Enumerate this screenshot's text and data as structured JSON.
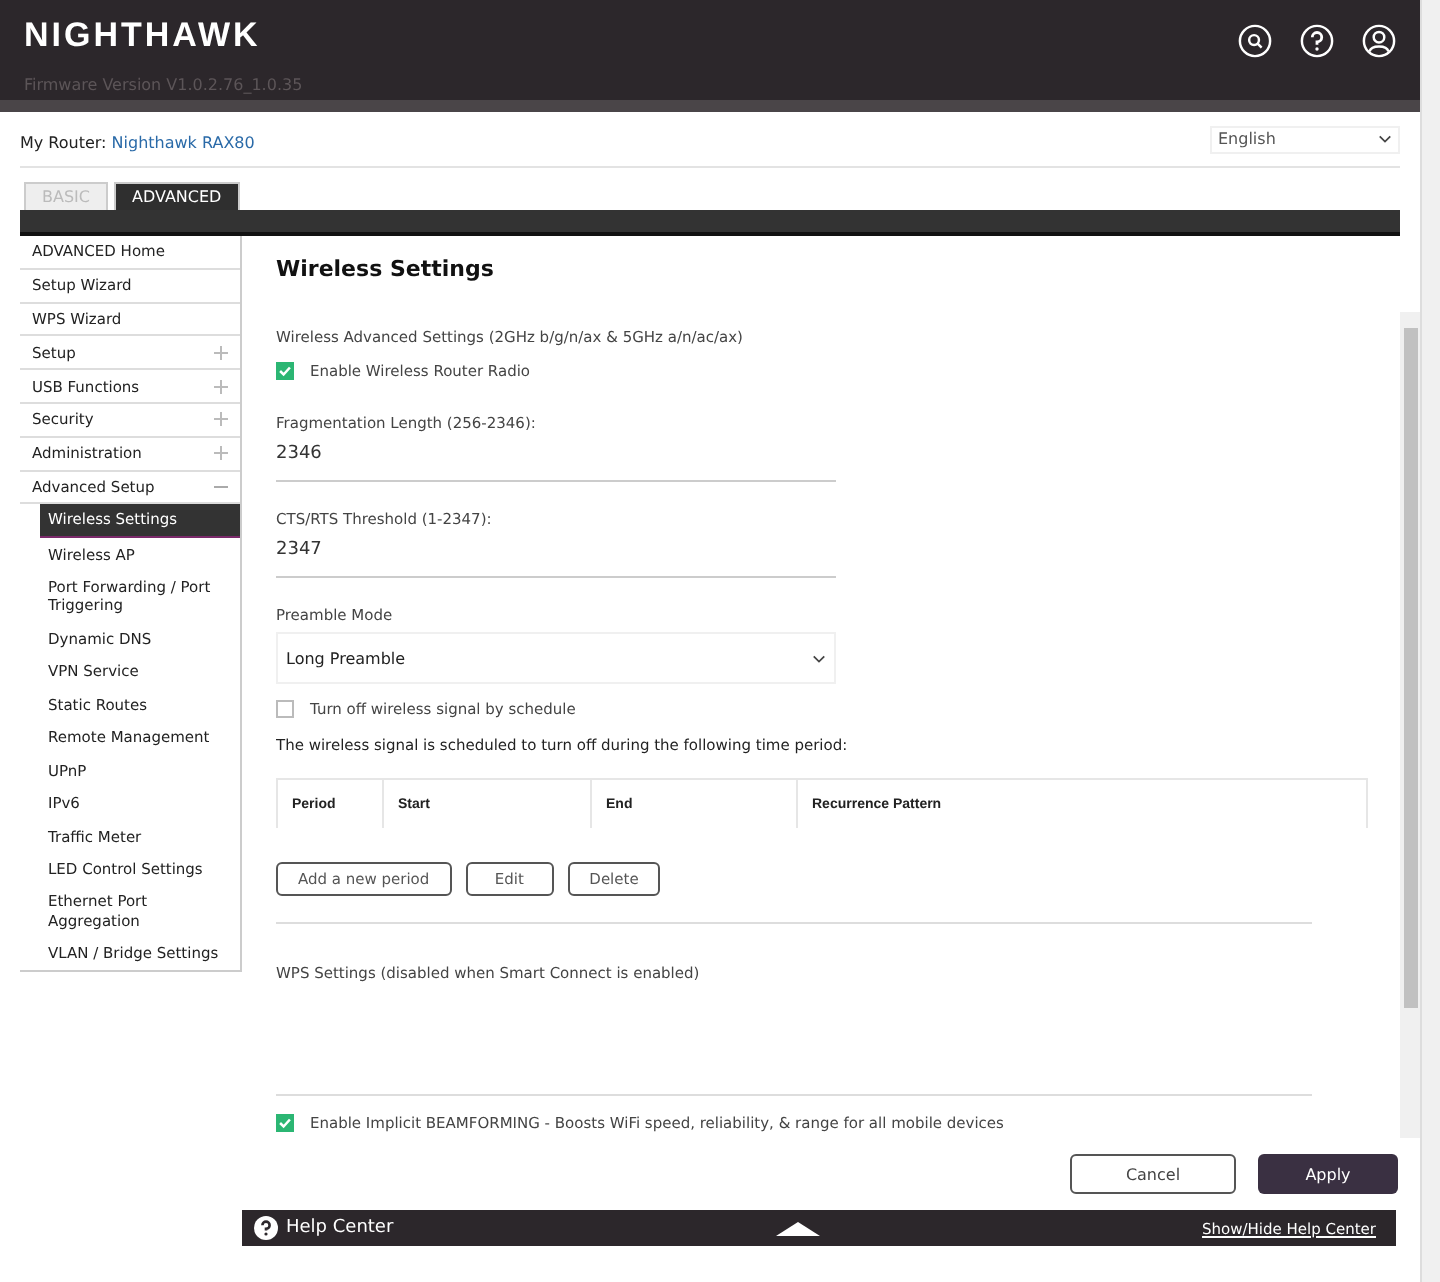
{
  "header": {
    "logo": "NIGHTHAWK",
    "firmware": "Firmware Version V1.0.2.76_1.0.35"
  },
  "router": {
    "label": "My Router:",
    "name": "Nighthawk RAX80"
  },
  "language": {
    "value": "English"
  },
  "tabs": [
    {
      "label": "BASIC",
      "selected": false
    },
    {
      "label": "ADVANCED",
      "selected": true
    }
  ],
  "sidebar": {
    "items": [
      {
        "label": "ADVANCED Home",
        "kind": "link"
      },
      {
        "label": "Setup Wizard",
        "kind": "link"
      },
      {
        "label": "WPS Wizard",
        "kind": "link"
      },
      {
        "label": "Setup",
        "kind": "group",
        "expanded": false
      },
      {
        "label": "USB Functions",
        "kind": "group",
        "expanded": false
      },
      {
        "label": "Security",
        "kind": "group",
        "expanded": false
      },
      {
        "label": "Administration",
        "kind": "group",
        "expanded": false
      },
      {
        "label": "Advanced Setup",
        "kind": "group",
        "expanded": true,
        "children": [
          {
            "label": "Wireless Settings",
            "selected": true
          },
          {
            "label": "Wireless AP",
            "selected": false
          },
          {
            "label": "Port Forwarding / Port Triggering",
            "selected": false
          },
          {
            "label": "Dynamic DNS",
            "selected": false
          },
          {
            "label": "VPN Service",
            "selected": false
          },
          {
            "label": "Static Routes",
            "selected": false
          },
          {
            "label": "Remote Management",
            "selected": false
          },
          {
            "label": "UPnP",
            "selected": false
          },
          {
            "label": "IPv6",
            "selected": false
          },
          {
            "label": "Traffic Meter",
            "selected": false
          },
          {
            "label": "LED Control Settings",
            "selected": false
          },
          {
            "label": "Ethernet Port Aggregation",
            "selected": false
          },
          {
            "label": "VLAN / Bridge Settings",
            "selected": false
          }
        ]
      }
    ]
  },
  "page": {
    "title": "Wireless Settings",
    "section": "Wireless Advanced Settings (2GHz b/g/n/ax & 5GHz a/n/ac/ax)",
    "enable_radio": {
      "label": "Enable Wireless Router Radio",
      "checked": true
    },
    "fragmentation": {
      "label": "Fragmentation Length (256-2346):",
      "value": "2346"
    },
    "cts_rts": {
      "label": "CTS/RTS Threshold (1-2347):",
      "value": "2347"
    },
    "preamble": {
      "label": "Preamble Mode",
      "value": "Long Preamble"
    },
    "schedule": {
      "label": "Turn off wireless signal by schedule",
      "checked": false
    },
    "schedule_note": "The wireless signal is scheduled to turn off during the following time period:",
    "table": {
      "columns": [
        "Period",
        "Start",
        "End",
        "Recurrence Pattern"
      ]
    },
    "table_buttons": [
      "Add a new period",
      "Edit",
      "Delete"
    ],
    "wps": "WPS Settings (disabled when Smart Connect is enabled)",
    "beamforming": {
      "label": "Enable Implicit BEAMFORMING - Boosts WiFi speed, reliability, & range for all mobile devices",
      "checked": true
    }
  },
  "buttons": {
    "cancel": "Cancel",
    "apply": "Apply"
  },
  "help": {
    "title": "Help Center",
    "toggle": "Show/Hide Help Center"
  }
}
